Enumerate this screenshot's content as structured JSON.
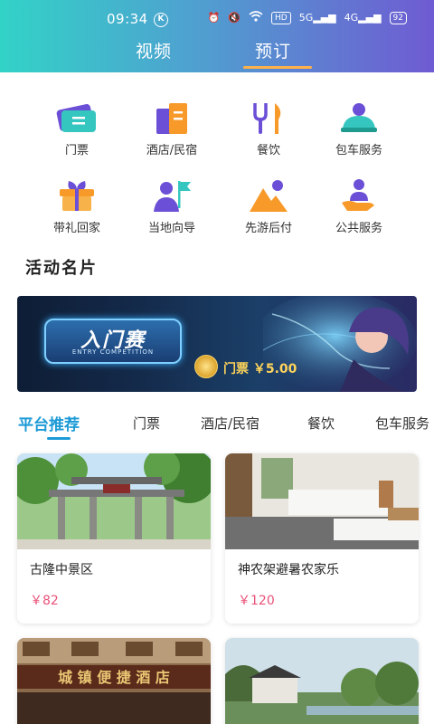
{
  "status": {
    "time": "09:34",
    "k_badge": "K",
    "hd": "HD",
    "sig1": "5G",
    "sig2": "4G",
    "battery": "92"
  },
  "header": {
    "tabs": [
      {
        "label": "视频"
      },
      {
        "label": "预订"
      }
    ]
  },
  "services": [
    {
      "label": "门票",
      "icon": "ticket-icon"
    },
    {
      "label": "酒店/民宿",
      "icon": "hotel-icon"
    },
    {
      "label": "餐饮",
      "icon": "dining-icon"
    },
    {
      "label": "包车服务",
      "icon": "charter-car-icon"
    },
    {
      "label": "带礼回家",
      "icon": "gift-icon"
    },
    {
      "label": "当地向导",
      "icon": "guide-icon"
    },
    {
      "label": "先游后付",
      "icon": "mountain-icon"
    },
    {
      "label": "公共服务",
      "icon": "public-service-icon"
    }
  ],
  "section_title": "活动名片",
  "banner": {
    "title": "入门赛",
    "subtitle": "ENTRY COMPETITION",
    "price_text": "门票 ￥5.00"
  },
  "category_tabs": [
    {
      "label": "平台推荐"
    },
    {
      "label": "门票"
    },
    {
      "label": "酒店/民宿"
    },
    {
      "label": "餐饮"
    },
    {
      "label": "包车服务"
    }
  ],
  "cards": [
    {
      "name": "古隆中景区",
      "price": "￥82"
    },
    {
      "name": "神农架避暑农家乐",
      "price": "￥120"
    },
    {
      "sign": "城 镇 便 捷 酒 店"
    }
  ],
  "colors": {
    "accent": "#1c9ad6",
    "price": "#e8527a",
    "header_start": "#32d3c7",
    "header_end": "#6f5bd2"
  }
}
